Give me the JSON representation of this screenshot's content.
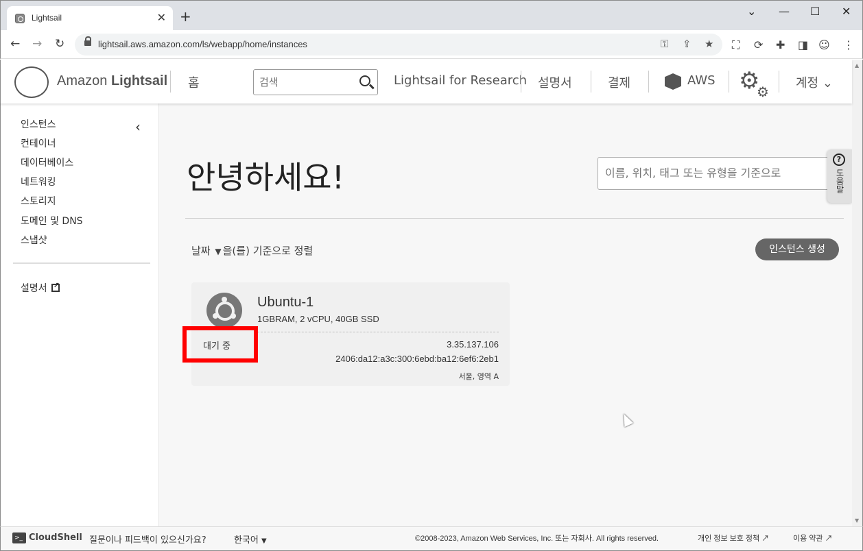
{
  "browser": {
    "tab_title": "Lightsail",
    "url": "lightsail.aws.amazon.com/ls/webapp/home/instances",
    "new_tab": "+",
    "close": "✕",
    "minimize": "—",
    "maximize": "☐",
    "window_close": "✕",
    "chevron": "⌄"
  },
  "header": {
    "logo_prefix": "Amazon ",
    "logo_bold": "Lightsail",
    "home": "홈",
    "search_placeholder": "검색",
    "research": "Lightsail for Research",
    "docs": "설명서",
    "billing": "결제",
    "aws": "AWS",
    "account": "계정 ⌄"
  },
  "sidebar": {
    "items": [
      "인스턴스",
      "컨테이너",
      "데이터베이스",
      "네트워킹",
      "스토리지",
      "도메인 및 DNS",
      "스냅샷"
    ],
    "docs": "설명서"
  },
  "main": {
    "greeting": "안녕하세요!",
    "filter_placeholder": "이름, 위치, 태그 또는 유형을 기준으로",
    "sort_field": "날짜",
    "sort_suffix": "을(를) 기준으로 정렬",
    "create_button": "인스턴스 생성",
    "help_label": "도움말"
  },
  "instance": {
    "name": "Ubuntu-1",
    "spec": "1GBRAM, 2 vCPU, 40GB SSD",
    "status": "대기 중",
    "ipv4": "3.35.137.106",
    "ipv6": "2406:da12:a3c:300:6ebd:ba12:6ef6:2eb1",
    "region": "서울, 영역 A"
  },
  "footer": {
    "cloudshell": "CloudShell",
    "feedback": "질문이나 피드백이 있으신가요?",
    "language": "한국어",
    "copyright": "©2008-2023, Amazon Web Services, Inc. 또는 자회사. All rights reserved.",
    "privacy": "개인 정보 보호 정책",
    "terms": "이용 약관"
  }
}
